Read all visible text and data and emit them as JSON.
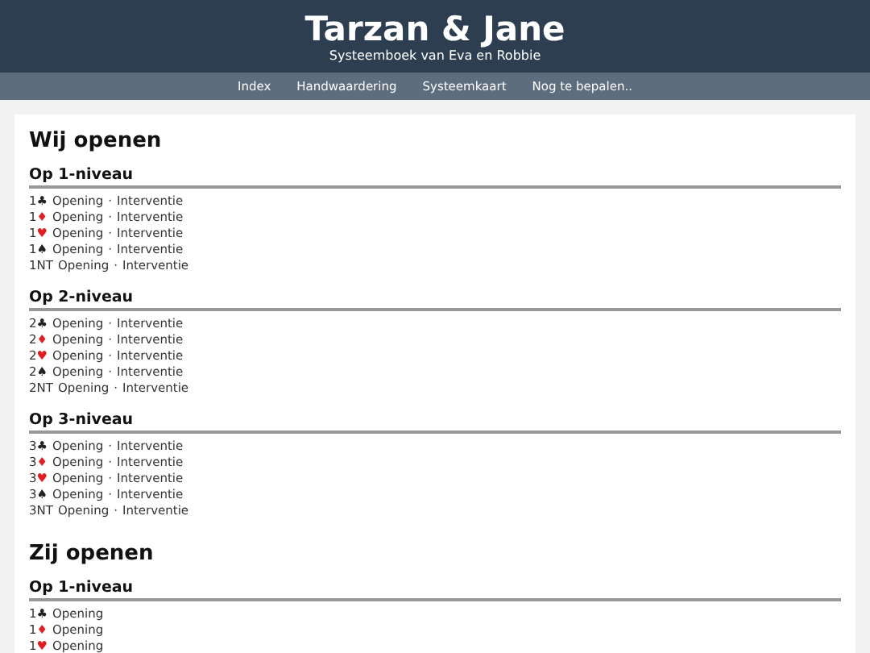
{
  "header": {
    "title": "Tarzan & Jane",
    "subtitle": "Systeemboek van Eva en Robbie"
  },
  "nav": [
    "Index",
    "Handwaardering",
    "Systeemkaart",
    "Nog te bepalen.."
  ],
  "sections": [
    {
      "title": "Wij openen",
      "groups": [
        {
          "title": "Op 1-niveau",
          "rows": [
            {
              "bid": "1",
              "suit": "♣",
              "color": "#222222",
              "items": [
                "Opening",
                "Interventie"
              ],
              "separator": "·"
            },
            {
              "bid": "1",
              "suit": "♦",
              "color": "#e02020",
              "items": [
                "Opening",
                "Interventie"
              ],
              "separator": "·"
            },
            {
              "bid": "1",
              "suit": "♥",
              "color": "#e02020",
              "items": [
                "Opening",
                "Interventie"
              ],
              "separator": "·"
            },
            {
              "bid": "1",
              "suit": "♠",
              "color": "#222222",
              "items": [
                "Opening",
                "Interventie"
              ],
              "separator": "·"
            },
            {
              "bid": "1NT",
              "items": [
                "Opening",
                "Interventie"
              ],
              "separator": "·"
            }
          ]
        },
        {
          "title": "Op 2-niveau",
          "rows": [
            {
              "bid": "2",
              "suit": "♣",
              "color": "#222222",
              "items": [
                "Opening",
                "Interventie"
              ],
              "separator": "·"
            },
            {
              "bid": "2",
              "suit": "♦",
              "color": "#e02020",
              "items": [
                "Opening",
                "Interventie"
              ],
              "separator": "·"
            },
            {
              "bid": "2",
              "suit": "♥",
              "color": "#e02020",
              "items": [
                "Opening",
                "Interventie"
              ],
              "separator": "·"
            },
            {
              "bid": "2",
              "suit": "♠",
              "color": "#222222",
              "items": [
                "Opening",
                "Interventie"
              ],
              "separator": "·"
            },
            {
              "bid": "2NT",
              "items": [
                "Opening",
                "Interventie"
              ],
              "separator": "·"
            }
          ]
        },
        {
          "title": "Op 3-niveau",
          "rows": [
            {
              "bid": "3",
              "suit": "♣",
              "color": "#222222",
              "items": [
                "Opening",
                "Interventie"
              ],
              "separator": "·"
            },
            {
              "bid": "3",
              "suit": "♦",
              "color": "#e02020",
              "items": [
                "Opening",
                "Interventie"
              ],
              "separator": "·"
            },
            {
              "bid": "3",
              "suit": "♥",
              "color": "#e02020",
              "items": [
                "Opening",
                "Interventie"
              ],
              "separator": "·"
            },
            {
              "bid": "3",
              "suit": "♠",
              "color": "#222222",
              "items": [
                "Opening",
                "Interventie"
              ],
              "separator": "·"
            },
            {
              "bid": "3NT",
              "items": [
                "Opening",
                "Interventie"
              ],
              "separator": "·"
            }
          ]
        }
      ]
    },
    {
      "title": "Zij openen",
      "groups": [
        {
          "title": "Op 1-niveau",
          "rows": [
            {
              "bid": "1",
              "suit": "♣",
              "color": "#222222",
              "items": [
                "Opening"
              ]
            },
            {
              "bid": "1",
              "suit": "♦",
              "color": "#e02020",
              "items": [
                "Opening"
              ]
            },
            {
              "bid": "1",
              "suit": "♥",
              "color": "#e02020",
              "items": [
                "Opening"
              ]
            }
          ]
        }
      ]
    }
  ]
}
